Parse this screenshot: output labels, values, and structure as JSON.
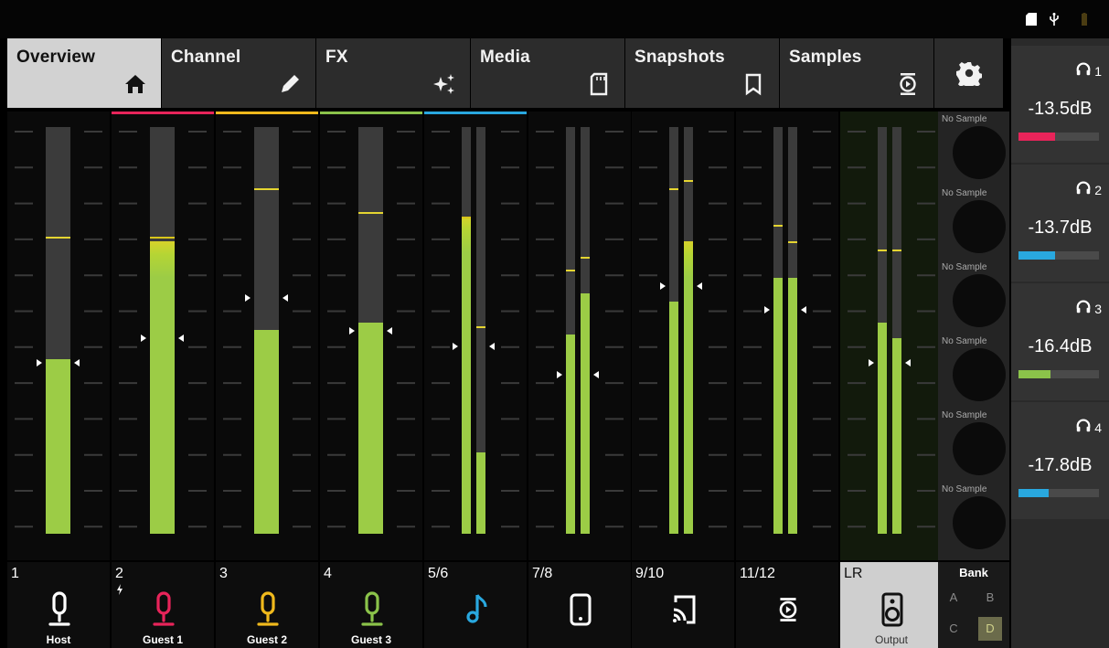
{
  "tabs": [
    {
      "label": "Overview",
      "active": true,
      "icon": "home-icon"
    },
    {
      "label": "Channel",
      "active": false,
      "icon": "pencil-icon"
    },
    {
      "label": "FX",
      "active": false,
      "icon": "sparkle-icon"
    },
    {
      "label": "Media",
      "active": false,
      "icon": "sd-card-icon"
    },
    {
      "label": "Snapshots",
      "active": false,
      "icon": "bookmark-icon"
    },
    {
      "label": "Samples",
      "active": false,
      "icon": "sample-player-icon"
    }
  ],
  "settings": {
    "icon": "gear-icon"
  },
  "status_icons": [
    "sd-card-icon",
    "usb-icon",
    "battery-icon"
  ],
  "channels": [
    {
      "number": "1",
      "name": "Host",
      "icon": "microphone-icon",
      "color": "#ffffff",
      "accent": "",
      "levels": [
        0.43
      ],
      "peaks": [
        0.73
      ],
      "faders": [
        0.42
      ]
    },
    {
      "number": "2",
      "name": "Guest 1",
      "icon": "microphone-icon",
      "color": "#e8245a",
      "accent": "#e8245a",
      "phantom": true,
      "levels": [
        0.72
      ],
      "peaks": [
        0.73
      ],
      "faders": [
        0.48
      ]
    },
    {
      "number": "3",
      "name": "Guest 2",
      "icon": "microphone-icon",
      "color": "#f0b91c",
      "accent": "#f0b91c",
      "levels": [
        0.5
      ],
      "peaks": [
        0.85
      ],
      "faders": [
        0.58
      ]
    },
    {
      "number": "4",
      "name": "Guest 3",
      "icon": "microphone-icon",
      "color": "#8bc34a",
      "accent": "#8bc34a",
      "levels": [
        0.52
      ],
      "peaks": [
        0.79
      ],
      "faders": [
        0.5
      ]
    },
    {
      "number": "5/6",
      "name": "",
      "icon": "music-note-icon",
      "color": "#29a8df",
      "accent": "#29a8df",
      "levels": [
        0.78,
        0.2
      ],
      "peaks": [
        0.78,
        0.51
      ],
      "faders": [
        0.46
      ]
    },
    {
      "number": "7/8",
      "name": "",
      "icon": "phone-icon",
      "color": "#ffffff",
      "accent": "",
      "levels": [
        0.49,
        0.59
      ],
      "peaks": [
        0.65,
        0.68
      ],
      "faders": [
        0.39
      ]
    },
    {
      "number": "9/10",
      "name": "",
      "icon": "cast-icon",
      "color": "#ffffff",
      "accent": "",
      "levels": [
        0.57,
        0.72
      ],
      "peaks": [
        0.85,
        0.87
      ],
      "faders": [
        0.61
      ]
    },
    {
      "number": "11/12",
      "name": "",
      "icon": "sample-player-icon",
      "color": "#ffffff",
      "accent": "",
      "levels": [
        0.63,
        0.63
      ],
      "peaks": [
        0.76,
        0.72
      ],
      "faders": [
        0.55
      ]
    },
    {
      "number": "LR",
      "name": "Output",
      "icon": "speaker-icon",
      "color": "#111111",
      "accent": "",
      "output": true,
      "levels": [
        0.52,
        0.48
      ],
      "peaks": [
        0.7,
        0.7
      ],
      "faders": [
        0.42
      ]
    }
  ],
  "samples": {
    "pads": [
      "No Sample",
      "No Sample",
      "No Sample",
      "No Sample",
      "No Sample",
      "No Sample"
    ],
    "bank_title": "Bank",
    "bank_buttons": [
      {
        "label": "A",
        "selected": false
      },
      {
        "label": "B",
        "selected": false
      },
      {
        "label": "C",
        "selected": false
      },
      {
        "label": "D",
        "selected": true
      }
    ]
  },
  "headphones": [
    {
      "index": "1",
      "level": "-13.5dB",
      "color": "#e8245a",
      "fill": 0.45,
      "icon": "headphones-icon"
    },
    {
      "index": "2",
      "level": "-13.7dB",
      "color": "#29a8df",
      "fill": 0.45,
      "icon": "headphones-icon"
    },
    {
      "index": "3",
      "level": "-16.4dB",
      "color": "#8bc34a",
      "fill": 0.4,
      "icon": "headphones-icon"
    },
    {
      "index": "4",
      "level": "-17.8dB",
      "color": "#29a8df",
      "fill": 0.38,
      "icon": "headphones-icon"
    }
  ]
}
